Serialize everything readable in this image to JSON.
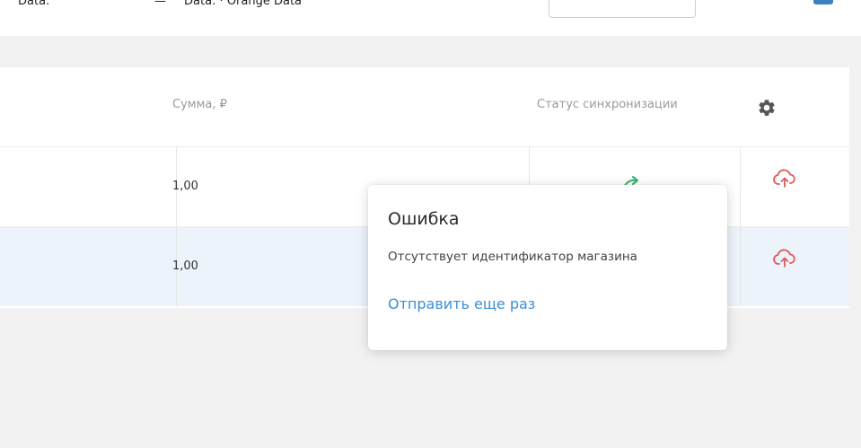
{
  "topbar": {
    "text1": "Data:",
    "text2": "—",
    "text3": "Data: · Orange Data",
    "box_value": ""
  },
  "table": {
    "columns": {
      "sum": "Сумма, ₽",
      "status": "Статус синхронизации"
    },
    "rows": [
      {
        "sum": "1,00"
      },
      {
        "sum": "1,00"
      }
    ]
  },
  "icons": {
    "settings": "gear-icon",
    "sync_ok": "sync-success-icon",
    "upload_error": "cloud-upload-icon"
  },
  "popover": {
    "title": "Ошибка",
    "message": "Отсутствует идентификатор магазина",
    "retry_link": "Отправить еще раз"
  },
  "colors": {
    "accent_link": "#3b8fd8",
    "sync_ok": "#3cb371",
    "upload_error": "#e05a5a",
    "selected_row": "#edf3fb"
  }
}
